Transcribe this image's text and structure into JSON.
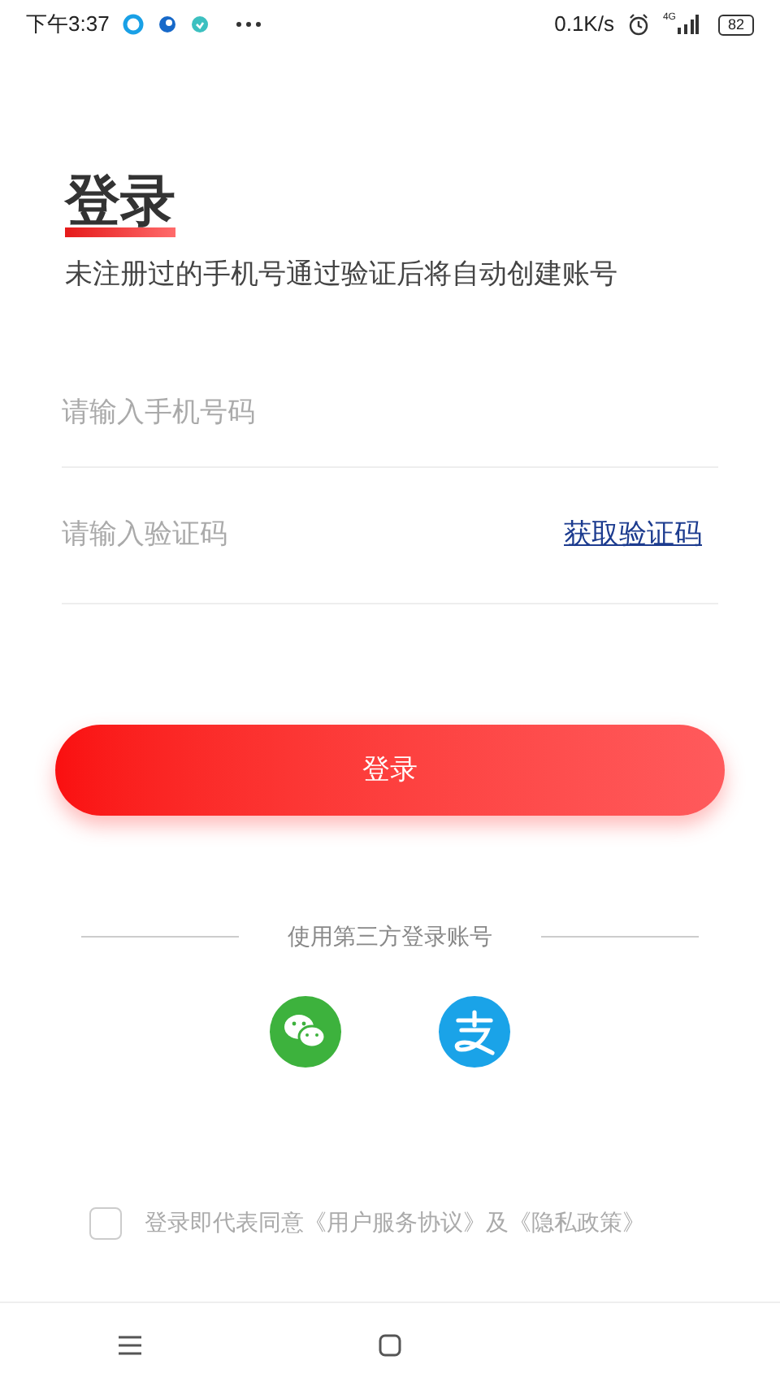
{
  "status_bar": {
    "time": "下午3:37",
    "net_speed": "0.1K/s",
    "network": "4G",
    "battery": "82"
  },
  "title": "登录",
  "subtitle": "未注册过的手机号通过验证后将自动创建账号",
  "phone_field": {
    "placeholder": "请输入手机号码"
  },
  "code_field": {
    "placeholder": "请输入验证码",
    "action": "获取验证码"
  },
  "login_button": "登录",
  "third_party": {
    "label": "使用第三方登录账号"
  },
  "agreement": {
    "checked": false,
    "text": "登录即代表同意《用户服务协议》及《隐私政策》"
  }
}
